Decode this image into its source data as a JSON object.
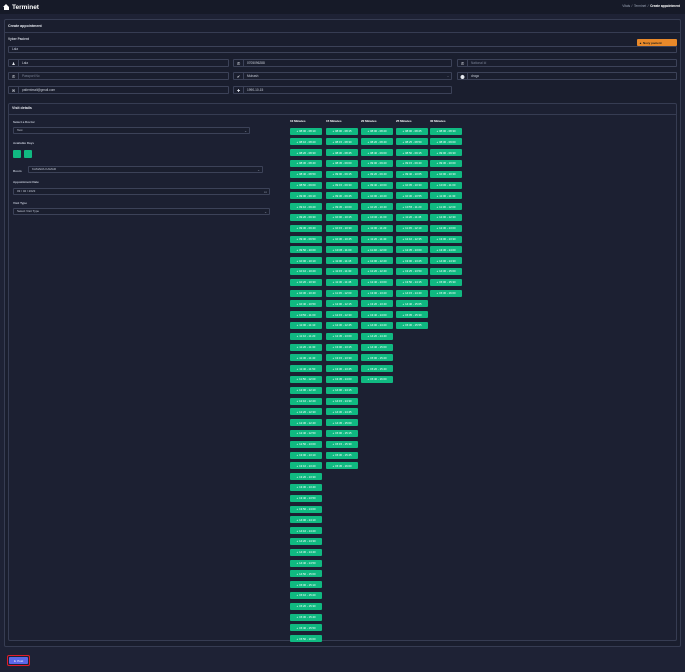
{
  "app": {
    "title": "Terminet"
  },
  "breadcrumb": {
    "home": "Vitals",
    "section": "Terminet",
    "current": "Create appointment"
  },
  "page": {
    "card_title": "Create appointment"
  },
  "patient": {
    "section_title": "Vyber Pacient",
    "search_value": "Lala",
    "new_button_label": "Novy pacient",
    "name": "Lala",
    "phone": "0705096288",
    "national_id_placeholder": "National Id",
    "passport_placeholder": "Passport No",
    "gender_value": "Muhash",
    "blood_value": "drogo",
    "email": "patientmail@gmail.com",
    "birth_date": "1990-10-15"
  },
  "visit": {
    "title": "Visit details",
    "doctor_label": "Select a Doctor",
    "doctor_value": "Test",
    "days_label": "Available Days",
    "room_label": "Room",
    "room_value": "KAMARA KAMAR",
    "date_label": "Appointment Date",
    "date_value": "03 / 02 / 2023",
    "type_label": "Visit Type",
    "type_placeholder": "Select Visit Type"
  },
  "slots": {
    "columns": [
      {
        "header": "10 Minutes",
        "items": [
          "08:00 - 08:10",
          "08:10 - 08:20",
          "08:20 - 08:30",
          "08:30 - 08:40",
          "08:40 - 08:50",
          "08:50 - 09:00",
          "09:00 - 09:10",
          "09:10 - 09:20",
          "09:20 - 09:30",
          "09:30 - 09:40",
          "09:40 - 09:50",
          "09:50 - 10:00",
          "10:00 - 10:10",
          "10:10 - 10:20",
          "10:20 - 10:30",
          "10:30 - 10:40",
          "10:40 - 10:50",
          "10:50 - 11:00",
          "11:00 - 11:10",
          "11:10 - 11:20",
          "11:20 - 11:30",
          "11:30 - 11:40",
          "11:40 - 11:50",
          "11:50 - 12:00",
          "12:00 - 12:10",
          "12:10 - 12:20",
          "12:20 - 12:30",
          "12:30 - 12:40",
          "12:40 - 12:50",
          "12:50 - 13:00",
          "13:00 - 13:10",
          "13:10 - 13:20",
          "13:20 - 13:30",
          "13:30 - 13:40",
          "13:40 - 13:50",
          "13:50 - 14:00",
          "14:00 - 14:10",
          "14:10 - 14:20",
          "14:20 - 14:30",
          "14:30 - 14:40",
          "14:40 - 14:50",
          "14:50 - 15:00",
          "15:00 - 15:10",
          "15:10 - 15:20",
          "15:20 - 15:30",
          "15:30 - 15:40",
          "15:40 - 15:50",
          "15:50 - 16:00"
        ]
      },
      {
        "header": "15 Minutes",
        "items": [
          "08:00 - 08:15",
          "08:15 - 08:30",
          "08:30 - 08:45",
          "08:45 - 09:00",
          "09:00 - 09:15",
          "09:15 - 09:30",
          "09:30 - 09:45",
          "09:45 - 10:00",
          "10:00 - 10:15",
          "10:15 - 10:30",
          "10:30 - 10:45",
          "10:45 - 11:00",
          "11:00 - 11:15",
          "11:15 - 11:30",
          "11:30 - 11:45",
          "11:45 - 12:00",
          "12:00 - 12:15",
          "12:15 - 12:30",
          "12:30 - 12:45",
          "12:45 - 13:00",
          "13:00 - 13:15",
          "13:15 - 13:30",
          "13:30 - 13:45",
          "13:45 - 14:00",
          "14:00 - 14:15",
          "14:15 - 14:30",
          "14:30 - 14:45",
          "14:45 - 15:00",
          "15:00 - 15:15",
          "15:15 - 15:30",
          "15:30 - 15:45",
          "15:45 - 16:00"
        ]
      },
      {
        "header": "20 Minutes",
        "items": [
          "08:00 - 08:20",
          "08:20 - 08:40",
          "08:40 - 09:00",
          "09:00 - 09:20",
          "09:20 - 09:40",
          "09:40 - 10:00",
          "10:00 - 10:20",
          "10:20 - 10:40",
          "10:40 - 11:00",
          "11:00 - 11:20",
          "11:20 - 11:40",
          "11:40 - 12:00",
          "12:00 - 12:20",
          "12:20 - 12:40",
          "12:40 - 13:00",
          "13:00 - 13:20",
          "13:20 - 13:40",
          "13:40 - 14:00",
          "14:00 - 14:20",
          "14:20 - 14:40",
          "14:40 - 15:00",
          "15:00 - 15:20",
          "15:20 - 15:40",
          "15:40 - 16:00"
        ]
      },
      {
        "header": "25 Minutes",
        "items": [
          "08:00 - 08:25",
          "08:25 - 08:50",
          "08:50 - 09:15",
          "09:15 - 09:40",
          "09:40 - 10:05",
          "10:05 - 10:30",
          "10:30 - 10:55",
          "10:55 - 11:20",
          "11:20 - 11:45",
          "11:45 - 12:10",
          "12:10 - 12:35",
          "12:35 - 13:00",
          "13:00 - 13:25",
          "13:25 - 13:50",
          "13:50 - 14:15",
          "14:15 - 14:40",
          "14:40 - 15:05",
          "15:05 - 15:30",
          "15:30 - 15:55"
        ]
      },
      {
        "header": "30 Minutes",
        "items": [
          "08:00 - 08:30",
          "08:30 - 09:00",
          "09:00 - 09:30",
          "09:30 - 10:00",
          "10:00 - 10:30",
          "10:30 - 11:00",
          "11:00 - 11:30",
          "11:30 - 12:00",
          "12:00 - 12:30",
          "12:30 - 13:00",
          "13:00 - 13:30",
          "13:30 - 14:00",
          "14:00 - 14:30",
          "14:30 - 15:00",
          "15:00 - 15:30",
          "15:30 - 16:00"
        ]
      }
    ]
  },
  "footer": {
    "post_label": "Post"
  }
}
